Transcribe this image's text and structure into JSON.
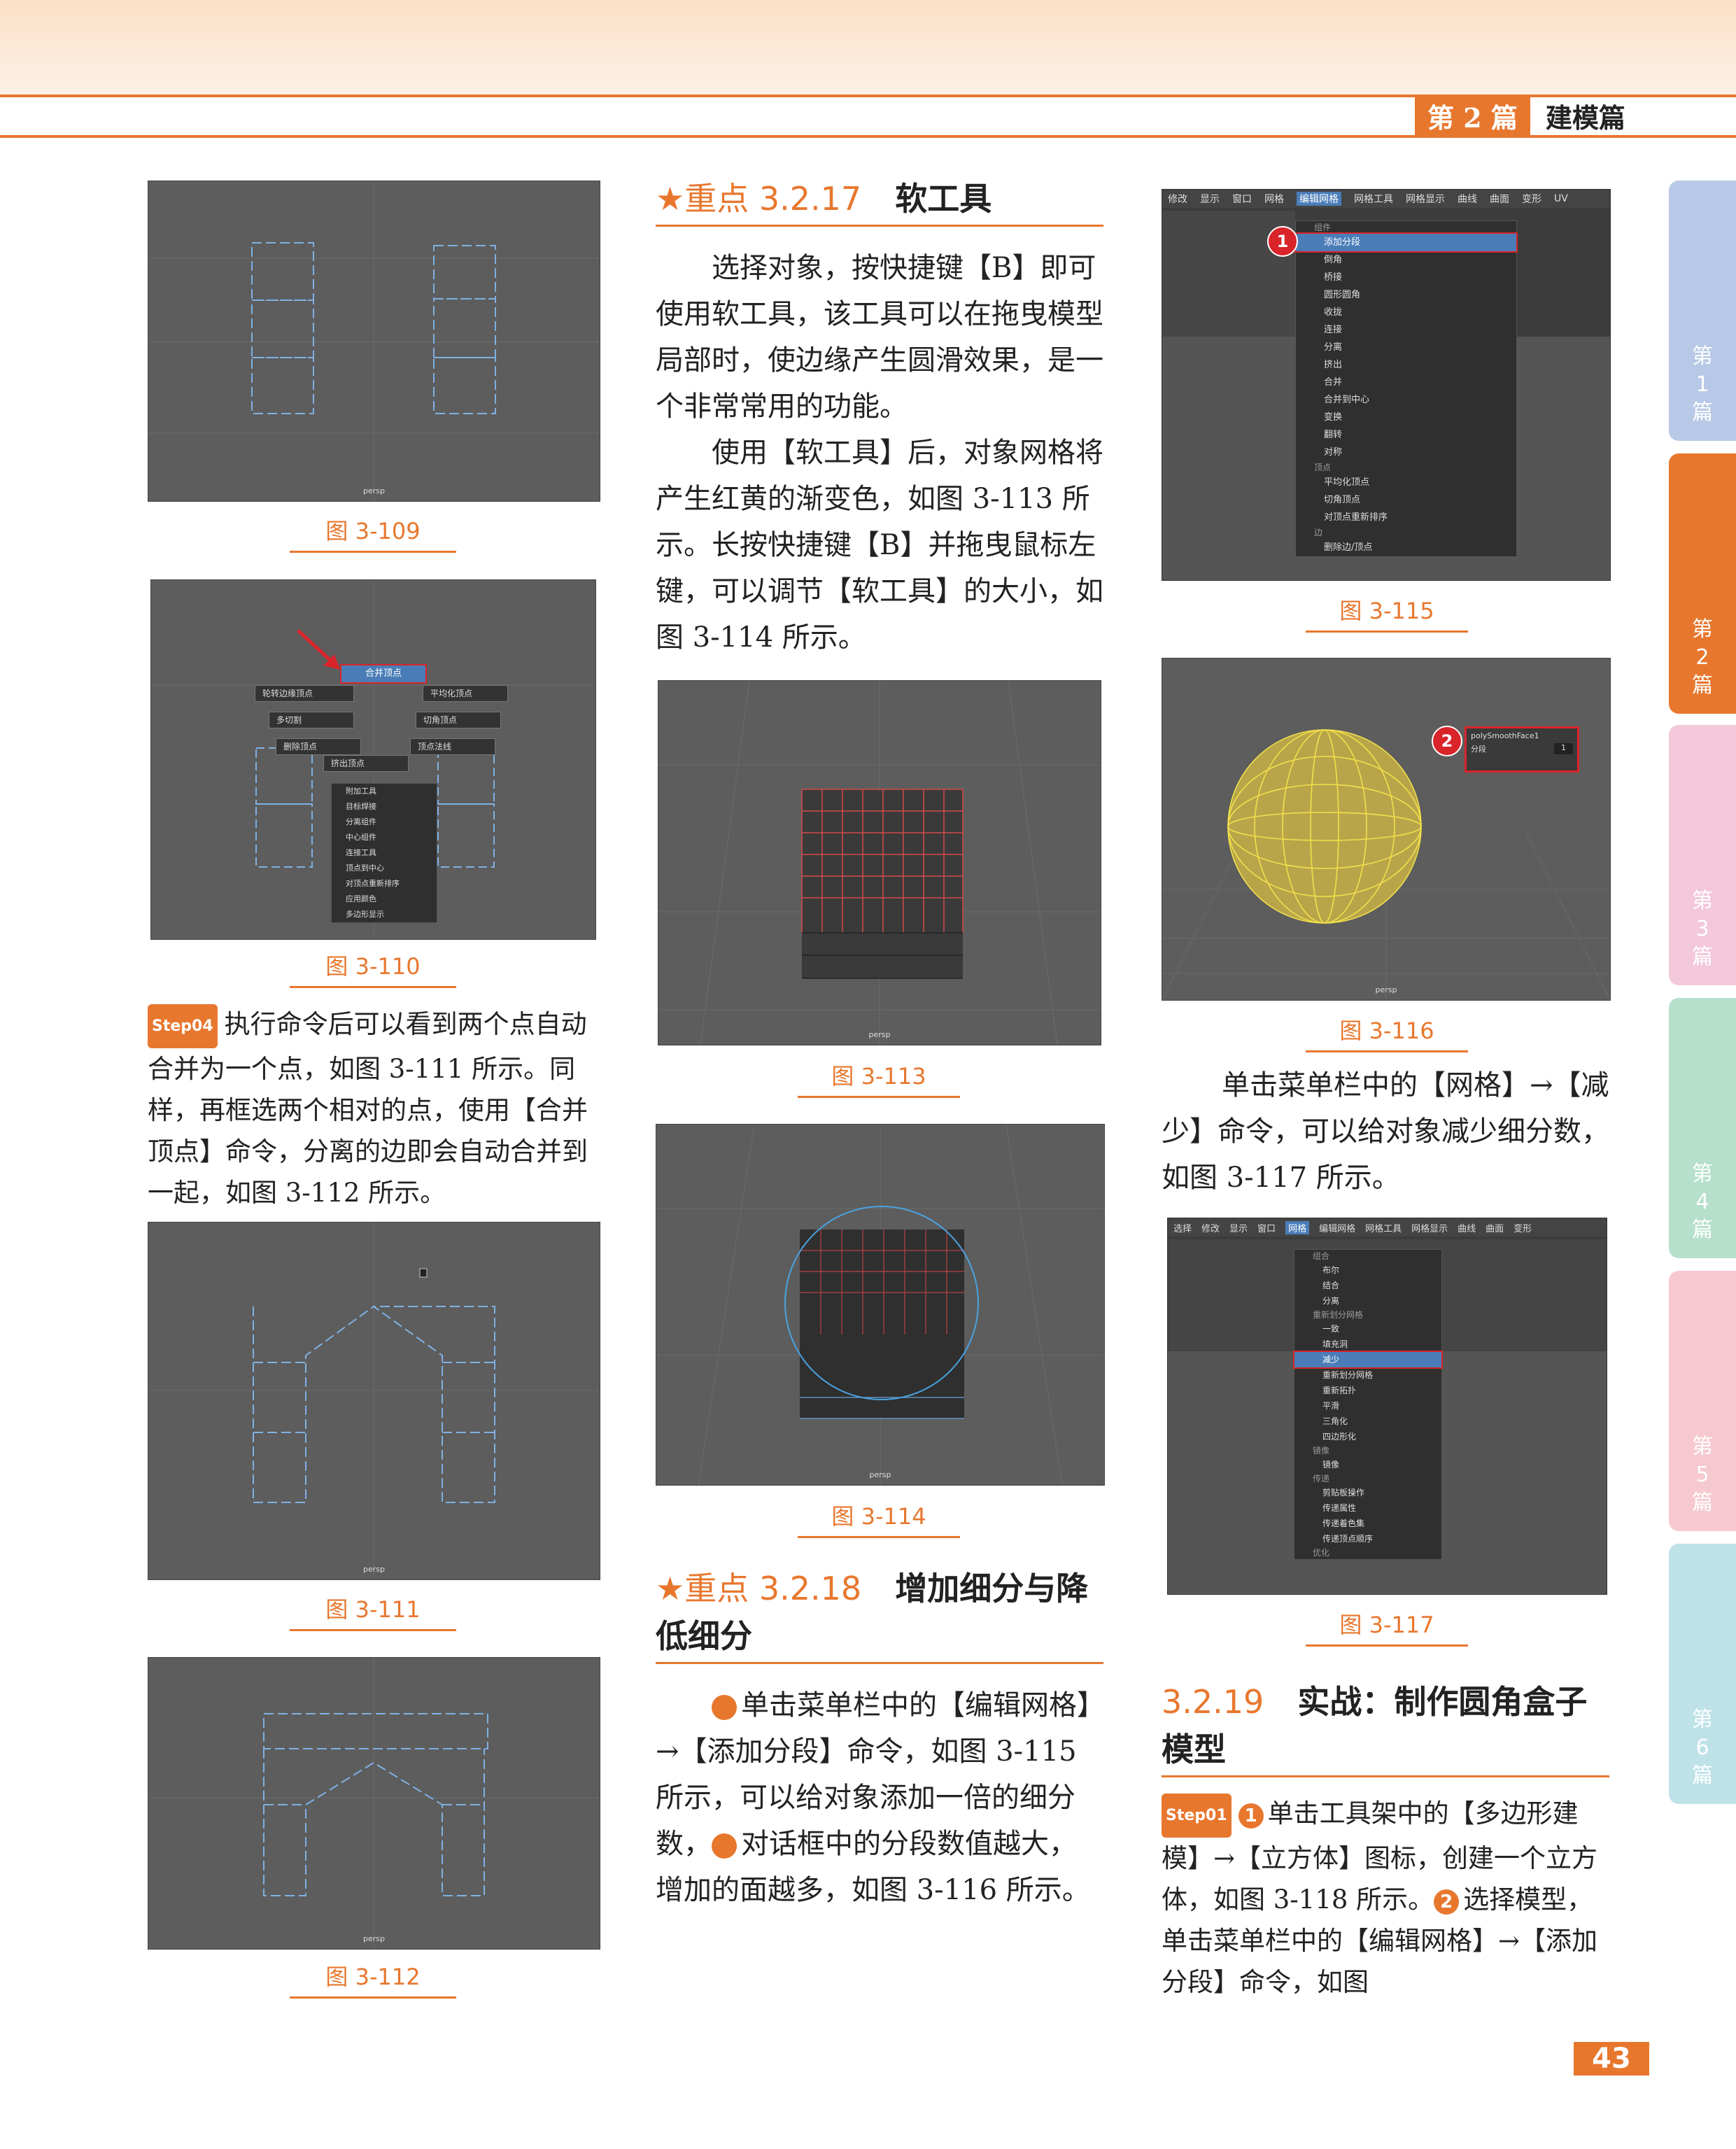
{
  "header": {
    "part_number": "第 2 篇",
    "part_name": "建模篇"
  },
  "left_column": {
    "captions": [
      "图 3-109",
      "图 3-110",
      "图 3-111",
      "图 3-112"
    ],
    "fig_110_menu": {
      "top": "合并顶点",
      "left_items": [
        "轮转边缘顶点",
        "多切割",
        "删除顶点"
      ],
      "right_items": [
        "平均化顶点",
        "切角顶点",
        "顶点法线"
      ],
      "center": "挤出顶点",
      "list": [
        "附加工具",
        "目标焊接",
        "分离组件",
        "中心组件",
        "连接工具",
        "顶点到中心",
        "对顶点重新排序",
        "应用颜色",
        "多边形显示"
      ]
    },
    "step04_badge": "Step",
    "step04_num": "04",
    "step04_text": "执行命令后可以看到两个点自动合并为一个点，如图 3-111 所示。同样，再框选两个相对的点，使用【合并顶点】命令，分离的边即会自动合并到一起，如图 3-112 所示。",
    "persp": "persp"
  },
  "middle_column": {
    "sec_3217": {
      "star": "★",
      "key": "重点 3.2.17",
      "title": "软工具"
    },
    "para1": "选择对象，按快捷键【B】即可使用软工具，该工具可以在拖曳模型局部时，使边缘产生圆滑效果，是一个非常常用的功能。",
    "para2": "使用【软工具】后，对象网格将产生红黄的渐变色，如图 3-113 所示。长按快捷键【B】并拖曳鼠标左键，可以调节【软工具】的大小，如图 3-114 所示。",
    "captions": [
      "图 3-113",
      "图 3-114"
    ],
    "sec_3218": {
      "star": "★",
      "key": "重点 3.2.18",
      "title": "增加细分与降低细分"
    },
    "para3_circle1": "1",
    "para3_a": "单击菜单栏中的【编辑网格】→【添加分段】命令，如图 3-115 所示，可以给对象添加一倍的细分数，",
    "para3_circle2": "2",
    "para3_b": "对话框中的分段数值越大，增加的面越多，如图 3-116 所示。"
  },
  "right_column": {
    "captions": [
      "图 3-115",
      "图 3-116",
      "图 3-117"
    ],
    "fig_115": {
      "menubar": [
        "修改",
        "显示",
        "窗口",
        "网格",
        "编辑网格",
        "网格工具",
        "网格显示",
        "曲线",
        "曲面",
        "变形",
        "UV"
      ],
      "highlight_index": 4,
      "menu": [
        "添加分段",
        "倒角",
        "桥接",
        "圆形圆角",
        "收拢",
        "连接",
        "分离",
        "挤出",
        "合并",
        "合并到中心",
        "变换",
        "翻转",
        "对称",
        "平均化顶点",
        "切角顶点",
        "对顶点重新排序",
        "删除边/顶点"
      ],
      "groups": [
        "组件",
        "顶点",
        "边"
      ],
      "badge": "1"
    },
    "fig_116": {
      "badge": "2",
      "dialog_title": "polySmoothFace1",
      "dialog_label": "分段",
      "dialog_value": "1"
    },
    "para4": "单击菜单栏中的【网格】→【减少】命令，可以给对象减少细分数，如图 3-117 所示。",
    "fig_117": {
      "menubar": [
        "选择",
        "修改",
        "显示",
        "窗口",
        "网格",
        "编辑网格",
        "网格工具",
        "网格显示",
        "曲线",
        "曲面",
        "变形"
      ],
      "highlight_index": 4,
      "menu": [
        "布尔",
        "结合",
        "分离",
        "一致",
        "填充洞",
        "减少",
        "重新划分网格",
        "重新拓扑",
        "平滑",
        "三角化",
        "四边形化",
        "镜像",
        "剪贴板操作",
        "传递属性",
        "传递着色集",
        "传递顶点顺序"
      ],
      "groups": [
        "组合",
        "重新划分网格",
        "镜像",
        "传递",
        "优化"
      ]
    },
    "sec_3219": {
      "key": "3.2.19",
      "title": "实战：制作圆角盒子模型"
    },
    "step01_badge": "Step",
    "step01_num": "01",
    "step01_circle1": "1",
    "step01_a": "单击工具架中的【多边形建模】→【立方体】图标，创建一个立方体，如图 3-118 所示。",
    "step01_circle2": "2",
    "step01_b": "选择模型，单击菜单栏中的【编辑网格】→【添加分段】命令，如图"
  },
  "side_tabs": [
    {
      "label": [
        "第",
        "1",
        "篇"
      ],
      "color": "#b7c9e6"
    },
    {
      "label": [
        "第",
        "2",
        "篇"
      ],
      "color": "#e8772e"
    },
    {
      "label": [
        "第",
        "3",
        "篇"
      ],
      "color": "#f3c8da"
    },
    {
      "label": [
        "第",
        "4",
        "篇"
      ],
      "color": "#b6e0cc"
    },
    {
      "label": [
        "第",
        "5",
        "篇"
      ],
      "color": "#f6c9d0"
    },
    {
      "label": [
        "第",
        "6",
        "篇"
      ],
      "color": "#bfe2e8"
    }
  ],
  "page_number": "43"
}
